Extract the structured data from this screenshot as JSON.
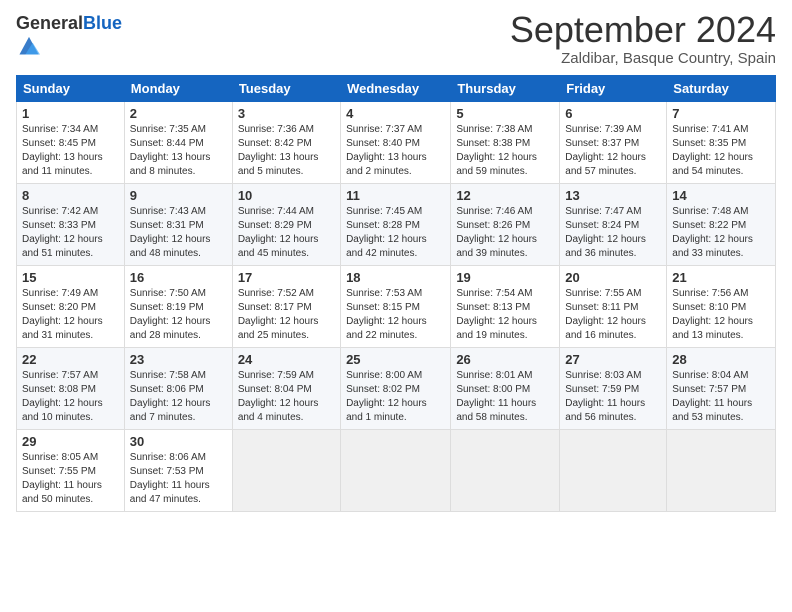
{
  "header": {
    "logo_general": "General",
    "logo_blue": "Blue",
    "month_title": "September 2024",
    "location": "Zaldibar, Basque Country, Spain"
  },
  "weekdays": [
    "Sunday",
    "Monday",
    "Tuesday",
    "Wednesday",
    "Thursday",
    "Friday",
    "Saturday"
  ],
  "weeks": [
    [
      {
        "day": "1",
        "info": "Sunrise: 7:34 AM\nSunset: 8:45 PM\nDaylight: 13 hours\nand 11 minutes."
      },
      {
        "day": "2",
        "info": "Sunrise: 7:35 AM\nSunset: 8:44 PM\nDaylight: 13 hours\nand 8 minutes."
      },
      {
        "day": "3",
        "info": "Sunrise: 7:36 AM\nSunset: 8:42 PM\nDaylight: 13 hours\nand 5 minutes."
      },
      {
        "day": "4",
        "info": "Sunrise: 7:37 AM\nSunset: 8:40 PM\nDaylight: 13 hours\nand 2 minutes."
      },
      {
        "day": "5",
        "info": "Sunrise: 7:38 AM\nSunset: 8:38 PM\nDaylight: 12 hours\nand 59 minutes."
      },
      {
        "day": "6",
        "info": "Sunrise: 7:39 AM\nSunset: 8:37 PM\nDaylight: 12 hours\nand 57 minutes."
      },
      {
        "day": "7",
        "info": "Sunrise: 7:41 AM\nSunset: 8:35 PM\nDaylight: 12 hours\nand 54 minutes."
      }
    ],
    [
      {
        "day": "8",
        "info": "Sunrise: 7:42 AM\nSunset: 8:33 PM\nDaylight: 12 hours\nand 51 minutes."
      },
      {
        "day": "9",
        "info": "Sunrise: 7:43 AM\nSunset: 8:31 PM\nDaylight: 12 hours\nand 48 minutes."
      },
      {
        "day": "10",
        "info": "Sunrise: 7:44 AM\nSunset: 8:29 PM\nDaylight: 12 hours\nand 45 minutes."
      },
      {
        "day": "11",
        "info": "Sunrise: 7:45 AM\nSunset: 8:28 PM\nDaylight: 12 hours\nand 42 minutes."
      },
      {
        "day": "12",
        "info": "Sunrise: 7:46 AM\nSunset: 8:26 PM\nDaylight: 12 hours\nand 39 minutes."
      },
      {
        "day": "13",
        "info": "Sunrise: 7:47 AM\nSunset: 8:24 PM\nDaylight: 12 hours\nand 36 minutes."
      },
      {
        "day": "14",
        "info": "Sunrise: 7:48 AM\nSunset: 8:22 PM\nDaylight: 12 hours\nand 33 minutes."
      }
    ],
    [
      {
        "day": "15",
        "info": "Sunrise: 7:49 AM\nSunset: 8:20 PM\nDaylight: 12 hours\nand 31 minutes."
      },
      {
        "day": "16",
        "info": "Sunrise: 7:50 AM\nSunset: 8:19 PM\nDaylight: 12 hours\nand 28 minutes."
      },
      {
        "day": "17",
        "info": "Sunrise: 7:52 AM\nSunset: 8:17 PM\nDaylight: 12 hours\nand 25 minutes."
      },
      {
        "day": "18",
        "info": "Sunrise: 7:53 AM\nSunset: 8:15 PM\nDaylight: 12 hours\nand 22 minutes."
      },
      {
        "day": "19",
        "info": "Sunrise: 7:54 AM\nSunset: 8:13 PM\nDaylight: 12 hours\nand 19 minutes."
      },
      {
        "day": "20",
        "info": "Sunrise: 7:55 AM\nSunset: 8:11 PM\nDaylight: 12 hours\nand 16 minutes."
      },
      {
        "day": "21",
        "info": "Sunrise: 7:56 AM\nSunset: 8:10 PM\nDaylight: 12 hours\nand 13 minutes."
      }
    ],
    [
      {
        "day": "22",
        "info": "Sunrise: 7:57 AM\nSunset: 8:08 PM\nDaylight: 12 hours\nand 10 minutes."
      },
      {
        "day": "23",
        "info": "Sunrise: 7:58 AM\nSunset: 8:06 PM\nDaylight: 12 hours\nand 7 minutes."
      },
      {
        "day": "24",
        "info": "Sunrise: 7:59 AM\nSunset: 8:04 PM\nDaylight: 12 hours\nand 4 minutes."
      },
      {
        "day": "25",
        "info": "Sunrise: 8:00 AM\nSunset: 8:02 PM\nDaylight: 12 hours\nand 1 minute."
      },
      {
        "day": "26",
        "info": "Sunrise: 8:01 AM\nSunset: 8:00 PM\nDaylight: 11 hours\nand 58 minutes."
      },
      {
        "day": "27",
        "info": "Sunrise: 8:03 AM\nSunset: 7:59 PM\nDaylight: 11 hours\nand 56 minutes."
      },
      {
        "day": "28",
        "info": "Sunrise: 8:04 AM\nSunset: 7:57 PM\nDaylight: 11 hours\nand 53 minutes."
      }
    ],
    [
      {
        "day": "29",
        "info": "Sunrise: 8:05 AM\nSunset: 7:55 PM\nDaylight: 11 hours\nand 50 minutes."
      },
      {
        "day": "30",
        "info": "Sunrise: 8:06 AM\nSunset: 7:53 PM\nDaylight: 11 hours\nand 47 minutes."
      },
      {
        "day": "",
        "info": ""
      },
      {
        "day": "",
        "info": ""
      },
      {
        "day": "",
        "info": ""
      },
      {
        "day": "",
        "info": ""
      },
      {
        "day": "",
        "info": ""
      }
    ]
  ]
}
